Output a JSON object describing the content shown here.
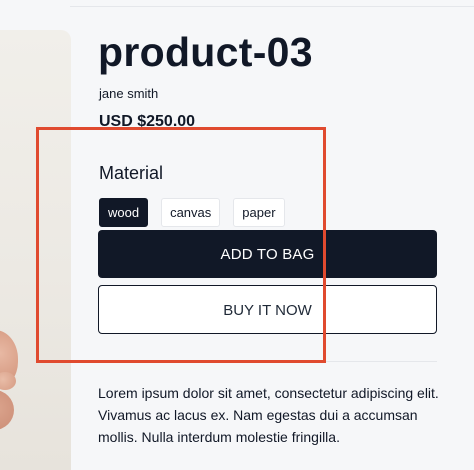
{
  "product": {
    "title": "product-03",
    "vendor": "jane smith",
    "price": "USD $250.00",
    "description": "Lorem ipsum dolor sit amet, consectetur adipiscing elit. Vivamus ac lacus ex. Nam egestas dui a accumsan mollis. Nulla interdum molestie fringilla."
  },
  "options": {
    "label": "Material",
    "values": [
      "wood",
      "canvas",
      "paper"
    ],
    "selected": "wood"
  },
  "actions": {
    "add_to_bag": "ADD TO BAG",
    "buy_now": "BUY IT NOW"
  },
  "colors": {
    "primary": "#111827",
    "highlight": "#e04a2f",
    "background": "#f6f7f9"
  }
}
